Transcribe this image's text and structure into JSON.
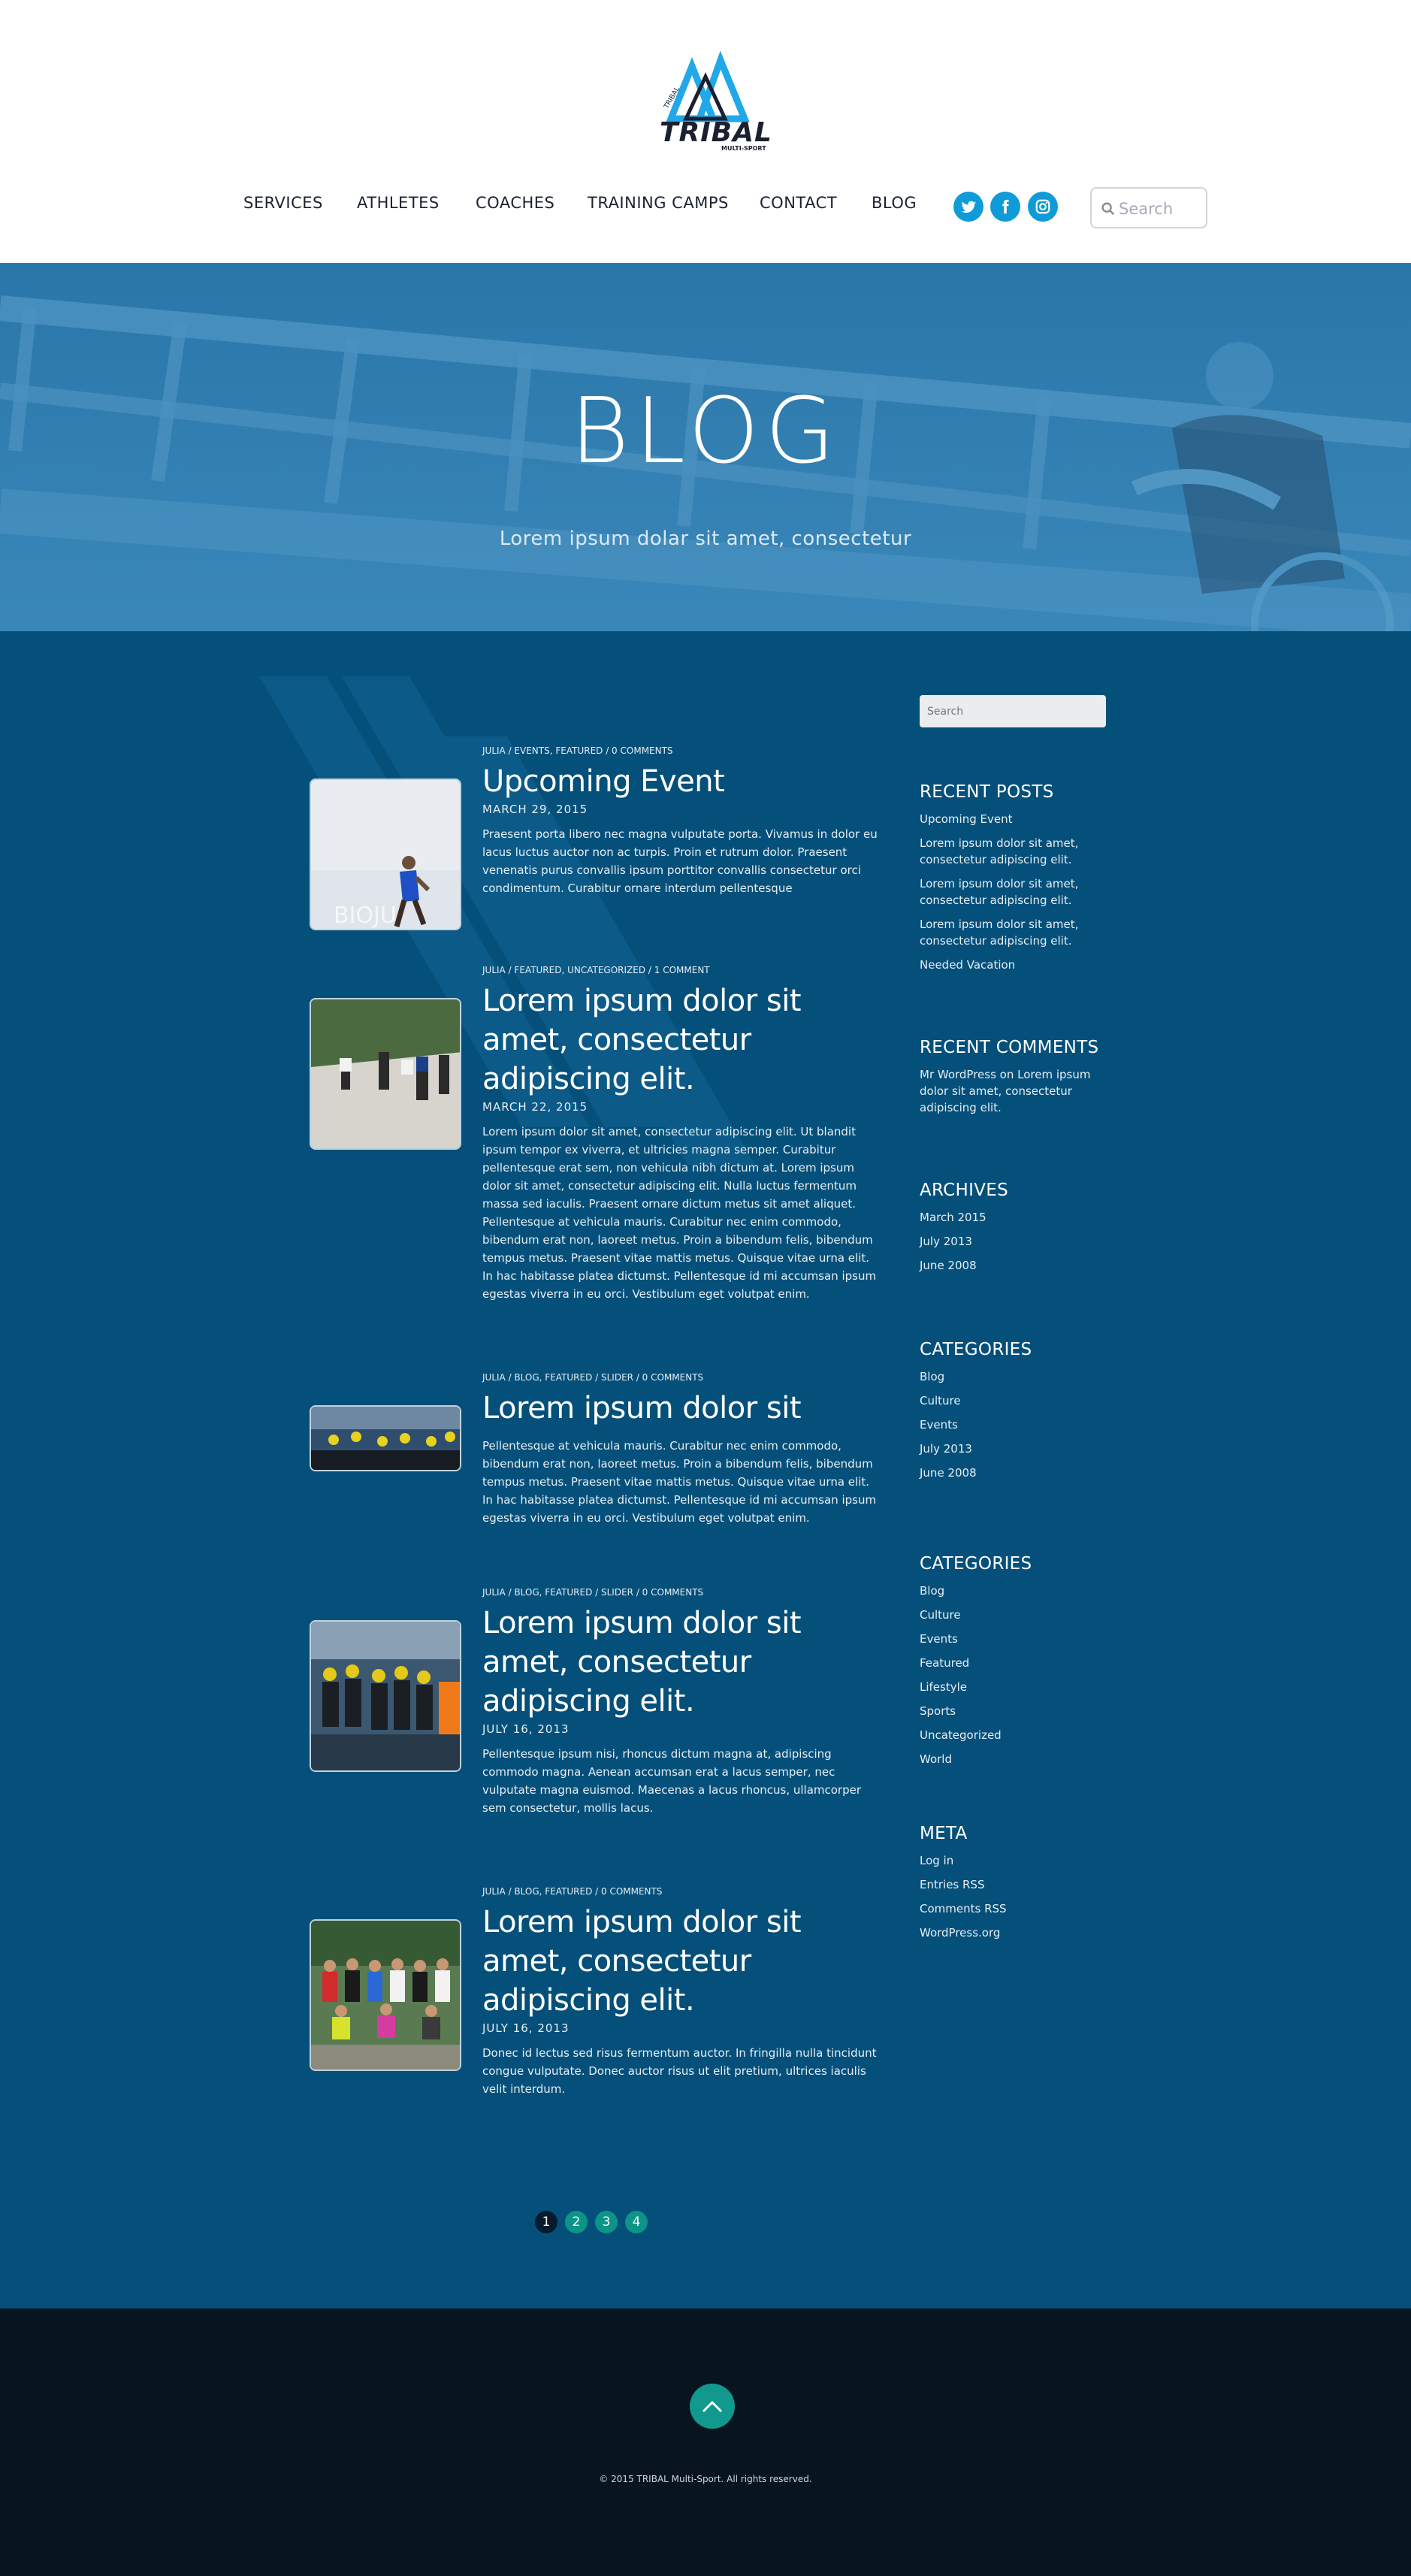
{
  "brand": {
    "name": "TRIBAL",
    "sub": "MULTI-SPORT"
  },
  "nav": {
    "items": [
      {
        "label": "SERVICES"
      },
      {
        "label": "ATHLETES"
      },
      {
        "label": "COACHES"
      },
      {
        "label": "TRAINING CAMPS"
      },
      {
        "label": "CONTACT"
      },
      {
        "label": "BLOG"
      }
    ],
    "social": [
      "twitter-icon",
      "facebook-icon",
      "instagram-icon"
    ],
    "search_placeholder": "Search"
  },
  "hero": {
    "title": "BLOG",
    "subtitle": "Lorem ipsum dolar sit amet, consectetur"
  },
  "posts": [
    {
      "meta": "JULIA / EVENTS, FEATURED / 0 COMMENTS",
      "title": "Upcoming Event",
      "date": "MARCH 29, 2015",
      "excerpt": "Praesent porta libero nec magna vulputate porta. Vivamus in dolor eu lacus luctus auctor non ac turpis. Proin et rutrum dolor. Praesent venenatis purus convallis ipsum porttitor convallis consectetur orci condimentum. Curabitur ornare interdum pellentesque"
    },
    {
      "meta": "JULIA / FEATURED, UNCATEGORIZED / 1 COMMENT",
      "title": "Lorem ipsum dolor sit amet, consectetur adipiscing elit.",
      "date": "MARCH 22, 2015",
      "excerpt": "Lorem ipsum dolor sit amet, consectetur adipiscing elit. Ut blandit ipsum tempor ex viverra, et ultricies magna semper. Curabitur pellentesque erat sem, non vehicula nibh dictum at. Lorem ipsum dolor sit amet, consectetur adipiscing elit. Nulla luctus fermentum massa sed iaculis. Praesent ornare dictum metus sit amet aliquet. Pellentesque at vehicula mauris. Curabitur nec enim commodo, bibendum erat non, laoreet metus. Proin a bibendum felis, bibendum tempus metus. Praesent vitae mattis metus. Quisque vitae urna elit. In hac habitasse platea dictumst. Pellentesque id mi accumsan ipsum egestas viverra in eu orci. Vestibulum eget volutpat enim."
    },
    {
      "meta": "JULIA / BLOG, FEATURED / SLIDER / 0 COMMENTS",
      "title": "Lorem ipsum dolor sit",
      "date": "",
      "excerpt": "Pellentesque at vehicula mauris. Curabitur nec enim commodo, bibendum erat non, laoreet metus. Proin a bibendum felis, bibendum tempus metus. Praesent vitae mattis metus. Quisque vitae urna elit. In hac habitasse platea dictumst. Pellentesque id mi accumsan ipsum egestas viverra in eu orci. Vestibulum eget volutpat enim."
    },
    {
      "meta": "JULIA / BLOG, FEATURED / SLIDER / 0 COMMENTS",
      "title": "Lorem ipsum dolor sit amet, consectetur adipiscing elit.",
      "date": "JULY 16, 2013",
      "excerpt": "Pellentesque ipsum nisi, rhoncus dictum magna at, adipiscing commodo magna. Aenean accumsan erat a lacus semper, nec vulputate magna euismod. Maecenas a lacus rhoncus, ullamcorper sem consectetur, mollis lacus."
    },
    {
      "meta": "JULIA / BLOG, FEATURED / 0 COMMENTS",
      "title": "Lorem ipsum dolor sit amet, consectetur adipiscing elit.",
      "date": "JULY 16, 2013",
      "excerpt": "Donec id lectus sed risus fermentum auctor. In fringilla nulla tincidunt congue vulputate. Donec auctor risus ut elit pretium, ultrices iaculis velit interdum."
    }
  ],
  "sidebar": {
    "search_placeholder": "Search",
    "recent_posts": {
      "title": "RECENT POSTS",
      "items": [
        "Upcoming Event",
        "Lorem ipsum dolor sit amet, consectetur adipiscing elit.",
        "Lorem ipsum dolor sit amet, consectetur adipiscing elit.",
        "Lorem ipsum dolor sit amet, consectetur adipiscing elit.",
        "Needed Vacation"
      ]
    },
    "recent_comments": {
      "title": "RECENT COMMENTS",
      "items": [
        "Mr WordPress on Lorem ipsum dolor sit amet, consectetur adipiscing elit."
      ]
    },
    "archives": {
      "title": "ARCHIVES",
      "items": [
        "March 2015",
        "July 2013",
        "June 2008"
      ]
    },
    "categories_a": {
      "title": "CATEGORIES",
      "items": [
        "Blog",
        "Culture",
        "Events",
        "July 2013",
        "June 2008"
      ]
    },
    "categories_b": {
      "title": "CATEGORIES",
      "items": [
        "Blog",
        "Culture",
        "Events",
        "Featured",
        "Lifestyle",
        "Sports",
        "Uncategorized",
        "World"
      ]
    },
    "meta": {
      "title": "META",
      "items": [
        "Log in",
        "Entries RSS",
        "Comments RSS",
        "WordPress.org"
      ]
    }
  },
  "pagination": {
    "pages": [
      "1",
      "2",
      "3",
      "4"
    ],
    "current": "1"
  },
  "footer": {
    "copyright": "© 2015 TRIBAL Multi-Sport. All rights reserved."
  },
  "colors": {
    "header_bg": "#ffffff",
    "hero_bg": "#2f7eb0",
    "main_bg": "#05507a",
    "footer_bg": "#081521",
    "accent": "#0f9bd8",
    "teal": "#10998c"
  }
}
